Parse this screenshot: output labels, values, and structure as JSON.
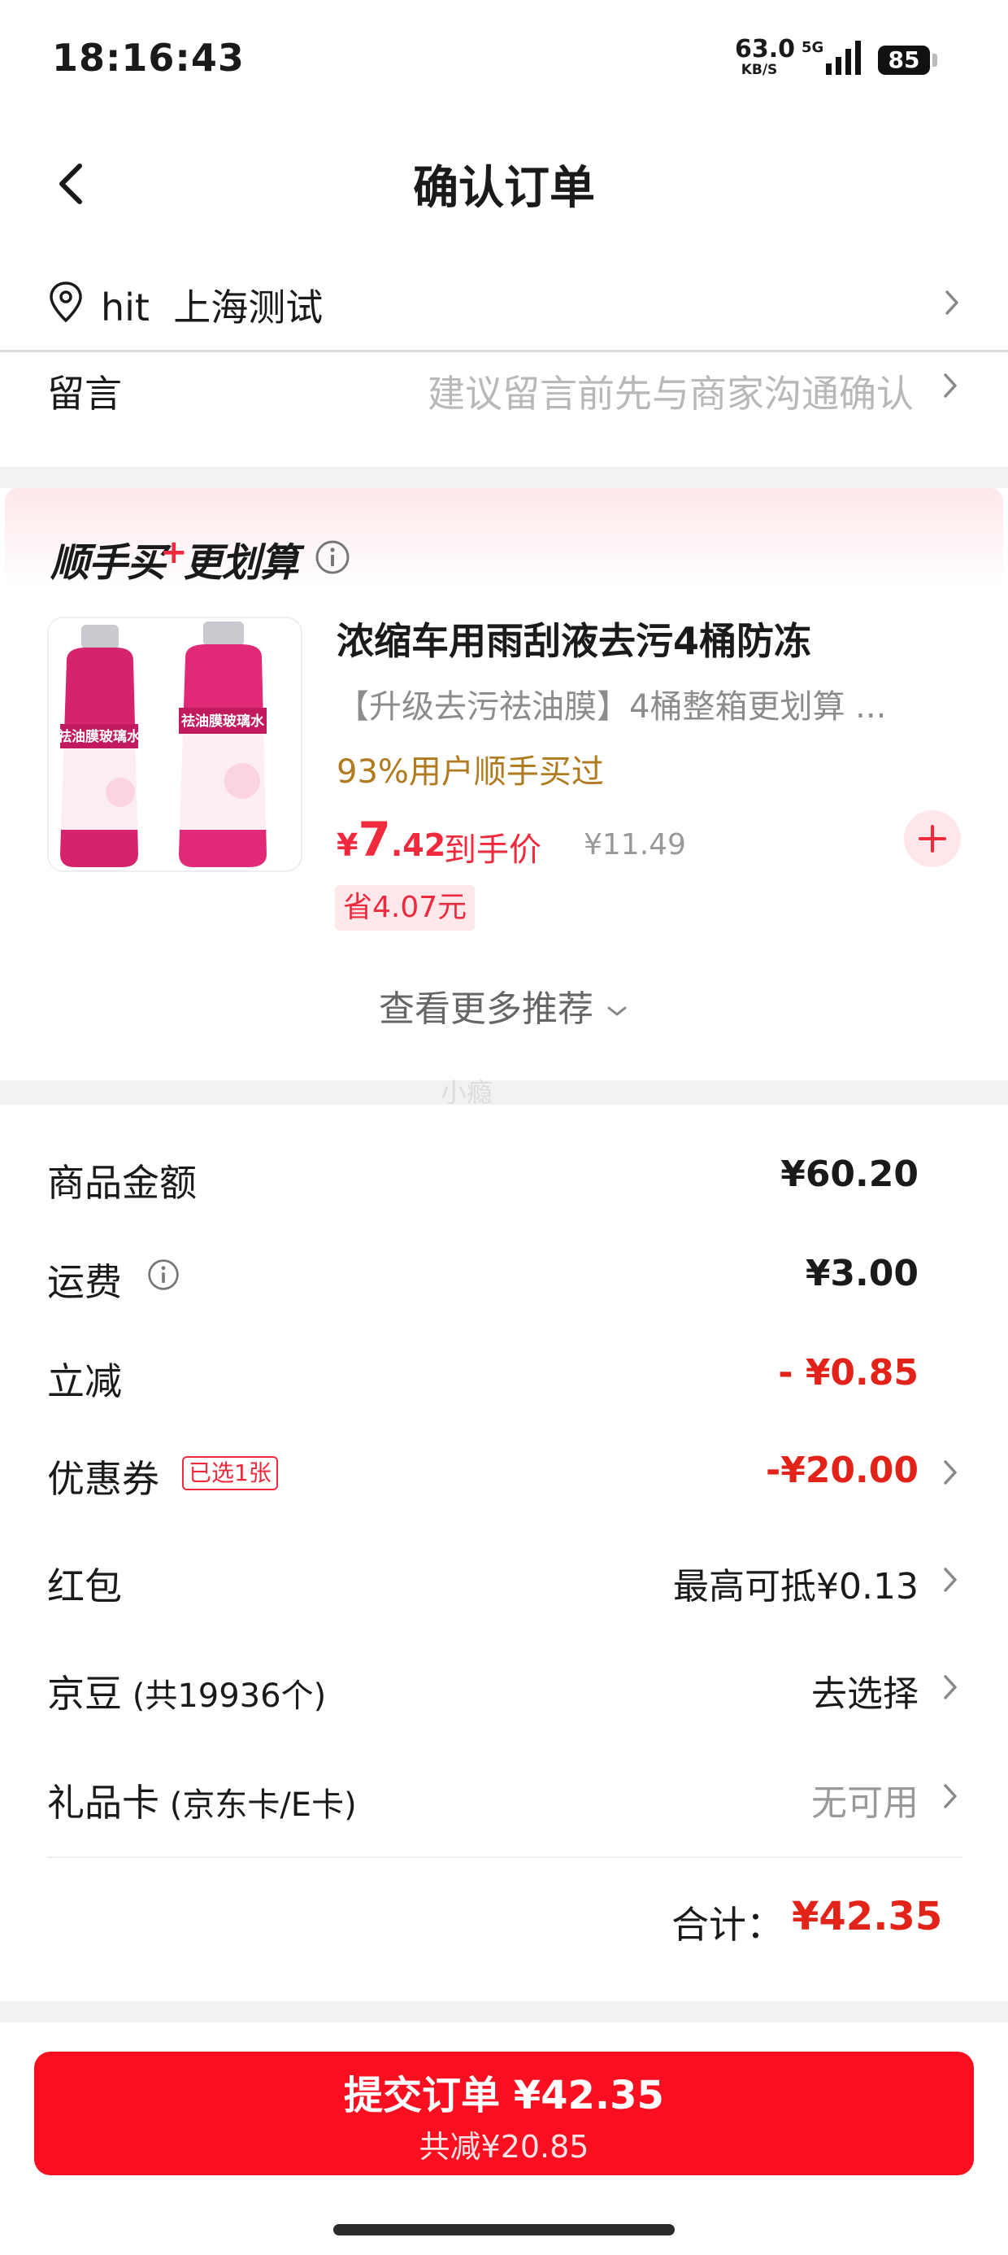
{
  "status_bar": {
    "time": "18:16:43",
    "net_speed": "63.0",
    "net_speed_unit": "KB/S",
    "network": "5G",
    "battery": "85"
  },
  "header": {
    "title": "确认订单"
  },
  "address": {
    "text": "hit  上海测试"
  },
  "message": {
    "label": "留言",
    "placeholder": "建议留言前先与商家沟通确认"
  },
  "recommend": {
    "title_part1": "顺手买",
    "title_plus": "+",
    "title_part2": "更划算",
    "product": {
      "name": "浓缩车用雨刮液去污4桶防冻",
      "desc": "【升级去污祛油膜】4桶整箱更划算 ...",
      "tag": "93%用户顺手买过",
      "price_symbol": "¥",
      "price_int": "7",
      "price_dec": ".42",
      "price_label": "到手价",
      "orig_price": "¥11.49",
      "save": "省4.07元",
      "image_label": "祛油膜玻璃水"
    },
    "see_more": "查看更多推荐"
  },
  "watermark": "小瘾",
  "summary": {
    "goods_amount": {
      "label": "商品金额",
      "value": "¥60.20"
    },
    "shipping": {
      "label": "运费",
      "value": "¥3.00"
    },
    "discount": {
      "label": "立减",
      "value": "- ¥0.85"
    },
    "coupon": {
      "label": "优惠券",
      "badge": "已选1张",
      "value": "-¥20.00"
    },
    "red_packet": {
      "label": "红包",
      "value": "最高可抵¥0.13"
    },
    "jingdou": {
      "label": "京豆",
      "sub": " (共19936个)",
      "value": "去选择"
    },
    "gift_card": {
      "label": "礼品卡",
      "sub": " (京东卡/E卡)",
      "value": "无可用"
    },
    "total_label": "合计：",
    "total_value": "¥42.35"
  },
  "submit": {
    "label": "提交订单 ¥42.35",
    "sub": "共减¥20.85"
  },
  "colors": {
    "accent": "#fa0f21",
    "price_red": "#e2231a",
    "tag_brown": "#b07a1f"
  },
  "icons": [
    "back-icon",
    "location-pin-icon",
    "chevron-right-icon",
    "info-icon",
    "plus-icon",
    "chevron-down-icon",
    "signal-icon"
  ]
}
